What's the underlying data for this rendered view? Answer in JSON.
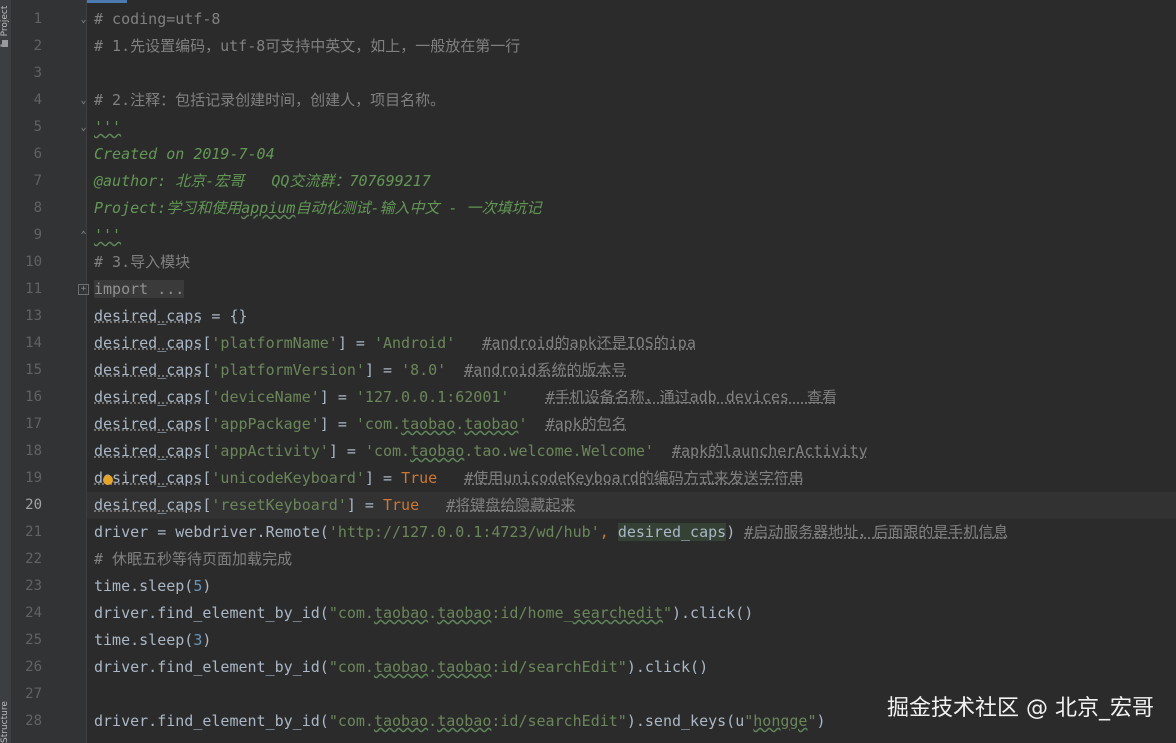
{
  "side_tabs": {
    "project_label": "1: Project",
    "structure_label": "Structure"
  },
  "editor": {
    "current_line": 20,
    "lines": [
      {
        "n": "1",
        "segs": [
          {
            "t": "# coding=utf-8",
            "c": "cm"
          }
        ]
      },
      {
        "n": "2",
        "segs": [
          {
            "t": "# 1.先设置编码，utf-8可支持中英文，如上，一般放在第一行",
            "c": "cm"
          }
        ]
      },
      {
        "n": "3",
        "segs": []
      },
      {
        "n": "4",
        "segs": [
          {
            "t": "# 2.注释：包括记录创建时间，创建人，项目名称。",
            "c": "cm"
          }
        ]
      },
      {
        "n": "5",
        "segs": [
          {
            "t": "'''",
            "c": "doc wavy"
          }
        ]
      },
      {
        "n": "6",
        "segs": [
          {
            "t": "Created on 2019-7-04",
            "c": "doc"
          }
        ]
      },
      {
        "n": "7",
        "segs": [
          {
            "t": "@author: 北京-宏哥   QQ交流群：707699217",
            "c": "doc"
          }
        ]
      },
      {
        "n": "8",
        "segs": [
          {
            "t": "Project:学习和使用",
            "c": "doc"
          },
          {
            "t": "appium",
            "c": "doc wavy"
          },
          {
            "t": "自动化测试-输入中文 - 一次填坑记",
            "c": "doc"
          }
        ]
      },
      {
        "n": "9",
        "segs": [
          {
            "t": "'''",
            "c": "doc wavy"
          }
        ]
      },
      {
        "n": "10",
        "segs": [
          {
            "t": "# 3.导入模块",
            "c": "cm"
          }
        ]
      },
      {
        "n": "11",
        "segs": [
          {
            "t": "import ...",
            "c": "kw-fold"
          }
        ]
      },
      {
        "n": "13",
        "segs": [
          {
            "t": "desired_caps",
            "c": "var dotted"
          },
          {
            "t": " = {}",
            "c": "var"
          }
        ]
      },
      {
        "n": "14",
        "segs": [
          {
            "t": "desired_caps",
            "c": "var dotted"
          },
          {
            "t": "[",
            "c": "var"
          },
          {
            "t": "'platformName'",
            "c": "str"
          },
          {
            "t": "] = ",
            "c": "var"
          },
          {
            "t": "'Android'",
            "c": "str"
          },
          {
            "t": "   ",
            "c": "var"
          },
          {
            "t": "#android的apk还是IOS的ipa",
            "c": "cm dotted"
          }
        ]
      },
      {
        "n": "15",
        "segs": [
          {
            "t": "desired_caps",
            "c": "var dotted"
          },
          {
            "t": "[",
            "c": "var"
          },
          {
            "t": "'platformVersion'",
            "c": "str"
          },
          {
            "t": "] = ",
            "c": "var"
          },
          {
            "t": "'8.0'",
            "c": "str"
          },
          {
            "t": "  ",
            "c": "var"
          },
          {
            "t": "#android系统的版本号",
            "c": "cm dotted"
          }
        ]
      },
      {
        "n": "16",
        "segs": [
          {
            "t": "desired_caps",
            "c": "var dotted"
          },
          {
            "t": "[",
            "c": "var"
          },
          {
            "t": "'deviceName'",
            "c": "str"
          },
          {
            "t": "] = ",
            "c": "var"
          },
          {
            "t": "'127.0.0.1:62001'",
            "c": "str"
          },
          {
            "t": "    ",
            "c": "var"
          },
          {
            "t": "#手机设备名称，通过adb devices  查看",
            "c": "cm dotted"
          }
        ]
      },
      {
        "n": "17",
        "segs": [
          {
            "t": "desired_caps",
            "c": "var dotted"
          },
          {
            "t": "[",
            "c": "var"
          },
          {
            "t": "'appPackage'",
            "c": "str"
          },
          {
            "t": "] = ",
            "c": "var"
          },
          {
            "t": "'com.",
            "c": "str"
          },
          {
            "t": "taobao",
            "c": "str wavy"
          },
          {
            "t": ".",
            "c": "str"
          },
          {
            "t": "taobao",
            "c": "str wavy"
          },
          {
            "t": "'",
            "c": "str"
          },
          {
            "t": "  ",
            "c": "var"
          },
          {
            "t": "#apk的包名",
            "c": "cm dotted"
          }
        ]
      },
      {
        "n": "18",
        "segs": [
          {
            "t": "desired_caps",
            "c": "var dotted"
          },
          {
            "t": "[",
            "c": "var"
          },
          {
            "t": "'appActivity'",
            "c": "str"
          },
          {
            "t": "] = ",
            "c": "var"
          },
          {
            "t": "'com.",
            "c": "str"
          },
          {
            "t": "taobao",
            "c": "str wavy"
          },
          {
            "t": ".tao.welcome.Welcome'",
            "c": "str"
          },
          {
            "t": "  ",
            "c": "var"
          },
          {
            "t": "#apk的launcherActivity",
            "c": "cm dotted"
          }
        ]
      },
      {
        "n": "19",
        "segs": [
          {
            "t": "desired_caps",
            "c": "var dotted"
          },
          {
            "t": "[",
            "c": "var"
          },
          {
            "t": "'unicodeKeyboard'",
            "c": "str"
          },
          {
            "t": "] = ",
            "c": "var"
          },
          {
            "t": "True",
            "c": "kw"
          },
          {
            "t": "   ",
            "c": "var"
          },
          {
            "t": "#使用unicodeKeyboard的编码方式来发送字符串",
            "c": "cm dotted"
          }
        ]
      },
      {
        "n": "20",
        "segs": [
          {
            "t": "desired_caps",
            "c": "var dotted"
          },
          {
            "t": "[",
            "c": "var"
          },
          {
            "t": "'resetKeyboard'",
            "c": "str"
          },
          {
            "t": "] = ",
            "c": "var"
          },
          {
            "t": "True",
            "c": "kw"
          },
          {
            "t": "   ",
            "c": "var"
          },
          {
            "t": "#将键盘给隐藏起来",
            "c": "cm dotted"
          }
        ]
      },
      {
        "n": "21",
        "segs": [
          {
            "t": "driver = webdriver.Remote(",
            "c": "var"
          },
          {
            "t": "'http://127.0.0.1:4723/wd/hub'",
            "c": "str"
          },
          {
            "t": ", ",
            "c": "kw"
          },
          {
            "t": "desired_caps",
            "c": "var hl-var"
          },
          {
            "t": ") ",
            "c": "var"
          },
          {
            "t": "#启动服务器地址，后面跟的是手机信息",
            "c": "cm dotted"
          }
        ]
      },
      {
        "n": "22",
        "segs": [
          {
            "t": "# 休眠五秒等待页面加载完成",
            "c": "cm"
          }
        ]
      },
      {
        "n": "23",
        "segs": [
          {
            "t": "time.sleep(",
            "c": "var"
          },
          {
            "t": "5",
            "c": "num"
          },
          {
            "t": ")",
            "c": "var"
          }
        ]
      },
      {
        "n": "24",
        "segs": [
          {
            "t": "driver.find_element_by_id(",
            "c": "var"
          },
          {
            "t": "\"com.",
            "c": "str"
          },
          {
            "t": "taobao",
            "c": "str wavy"
          },
          {
            "t": ".",
            "c": "str"
          },
          {
            "t": "taobao",
            "c": "str wavy"
          },
          {
            "t": ":id/home_",
            "c": "str"
          },
          {
            "t": "searchedit",
            "c": "str wavy"
          },
          {
            "t": "\"",
            "c": "str"
          },
          {
            "t": ").click()",
            "c": "var"
          }
        ]
      },
      {
        "n": "25",
        "segs": [
          {
            "t": "time.sleep(",
            "c": "var"
          },
          {
            "t": "3",
            "c": "num"
          },
          {
            "t": ")",
            "c": "var"
          }
        ]
      },
      {
        "n": "26",
        "segs": [
          {
            "t": "driver.find_element_by_id(",
            "c": "var"
          },
          {
            "t": "\"com.",
            "c": "str"
          },
          {
            "t": "taobao",
            "c": "str wavy"
          },
          {
            "t": ".",
            "c": "str"
          },
          {
            "t": "taobao",
            "c": "str wavy"
          },
          {
            "t": ":id/searchEdit\"",
            "c": "str"
          },
          {
            "t": ").click()",
            "c": "var"
          }
        ]
      },
      {
        "n": "27",
        "segs": []
      },
      {
        "n": "28",
        "segs": [
          {
            "t": "driver.find_element_by_id(",
            "c": "var"
          },
          {
            "t": "\"com.",
            "c": "str"
          },
          {
            "t": "taobao",
            "c": "str wavy"
          },
          {
            "t": ".",
            "c": "str"
          },
          {
            "t": "taobao",
            "c": "str wavy"
          },
          {
            "t": ":id/searchEdit\"",
            "c": "str"
          },
          {
            "t": ").send_keys(u",
            "c": "var"
          },
          {
            "t": "\"",
            "c": "str"
          },
          {
            "t": "hongge",
            "c": "str wavy"
          },
          {
            "t": "\"",
            "c": "str"
          },
          {
            "t": ")",
            "c": "var"
          }
        ]
      }
    ],
    "folds": [
      {
        "line": "1",
        "glyph": "⌄"
      },
      {
        "line": "4",
        "glyph": "⌄"
      },
      {
        "line": "5",
        "glyph": "⌄"
      },
      {
        "line": "9",
        "glyph": "⌃"
      },
      {
        "line": "11",
        "glyph": "+"
      }
    ]
  },
  "watermark": {
    "text": "掘金技术社区 @ 北京_宏哥"
  }
}
